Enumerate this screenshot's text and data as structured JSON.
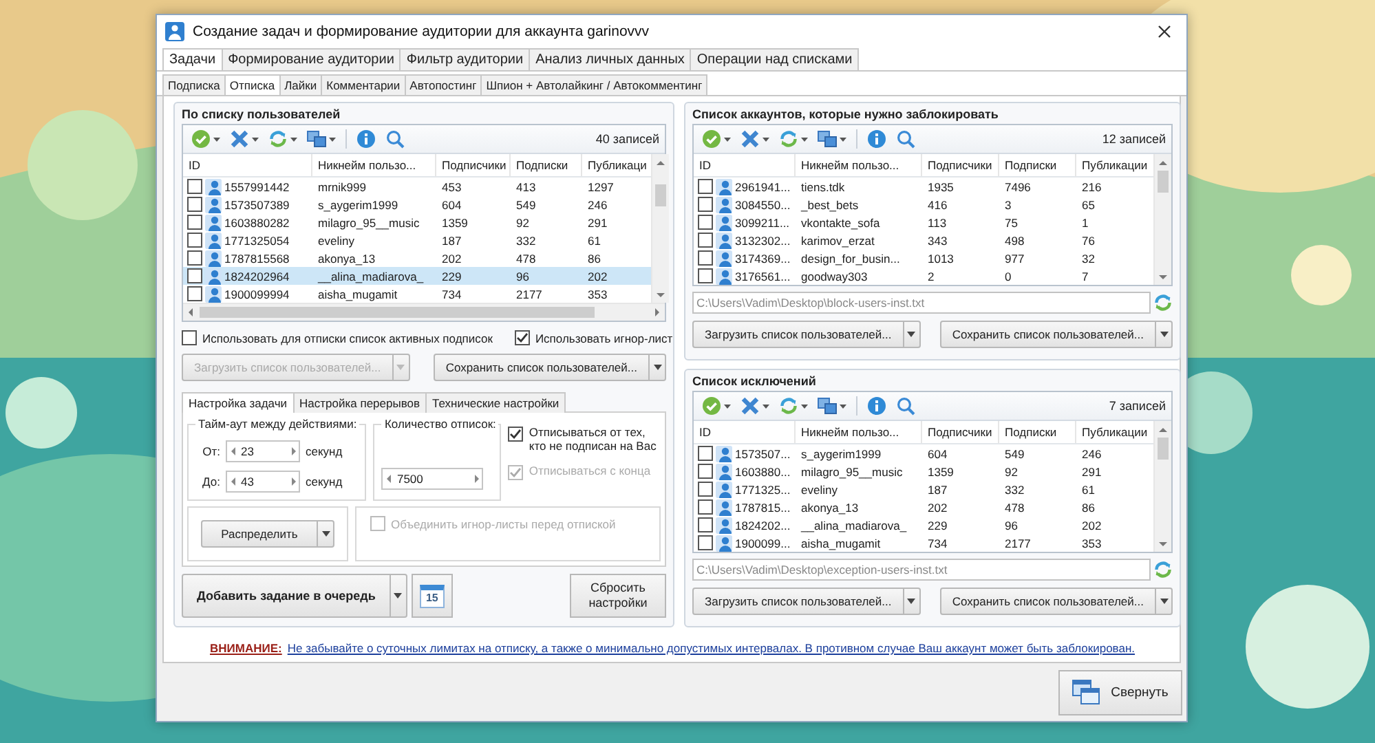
{
  "window": {
    "title": "Создание задач и формирование аудитории для аккаунта garinovvv"
  },
  "main_tabs": [
    {
      "label": "Задачи",
      "selected": true
    },
    {
      "label": "Формирование аудитории",
      "selected": false
    },
    {
      "label": "Фильтр аудитории",
      "selected": false
    },
    {
      "label": "Анализ личных данных",
      "selected": false
    },
    {
      "label": "Операции над списками",
      "selected": false
    }
  ],
  "sub_tabs": [
    {
      "label": "Подписка",
      "selected": false
    },
    {
      "label": "Отписка",
      "selected": true
    },
    {
      "label": "Лайки",
      "selected": false
    },
    {
      "label": "Комментарии",
      "selected": false
    },
    {
      "label": "Автопостинг",
      "selected": false
    },
    {
      "label": "Шпион + Автолайкинг / Автокомментинг",
      "selected": false
    }
  ],
  "user_list": {
    "title": "По списку пользователей",
    "count": "40 записей",
    "columns": [
      "ID",
      "Никнейм пользо...",
      "Подписчики",
      "Подписки",
      "Публикаци"
    ],
    "rows": [
      {
        "checked": false,
        "selected": false,
        "cells": [
          "1557991442",
          "mrnik999",
          "453",
          "413",
          "1297"
        ]
      },
      {
        "checked": false,
        "selected": false,
        "cells": [
          "1573507389",
          "s_aygerim1999",
          "604",
          "549",
          "246"
        ]
      },
      {
        "checked": false,
        "selected": false,
        "cells": [
          "1603880282",
          "milagro_95__music",
          "1359",
          "92",
          "291"
        ]
      },
      {
        "checked": false,
        "selected": false,
        "cells": [
          "1771325054",
          "eveliny",
          "187",
          "332",
          "61"
        ]
      },
      {
        "checked": false,
        "selected": false,
        "cells": [
          "1787815568",
          "akonya_13",
          "202",
          "478",
          "86"
        ]
      },
      {
        "checked": false,
        "selected": true,
        "cells": [
          "1824202964",
          "__alina_madiarova_",
          "229",
          "96",
          "202"
        ]
      },
      {
        "checked": false,
        "selected": false,
        "cells": [
          "1900099994",
          "aisha_mugamit",
          "734",
          "2177",
          "353"
        ]
      }
    ]
  },
  "options": [
    {
      "label": "Использовать для отписки список активных подписок",
      "checked": false
    },
    {
      "label": "Использовать игнор-лист",
      "checked": true
    }
  ],
  "list_buttons": [
    {
      "label": "Загрузить список пользователей...",
      "disabled": true
    },
    {
      "label": "Сохранить список пользователей...",
      "disabled": false
    }
  ],
  "settings_tabs": [
    {
      "label": "Настройка задачи",
      "selected": true
    },
    {
      "label": "Настройка перерывов",
      "selected": false
    },
    {
      "label": "Технические настройки",
      "selected": false
    }
  ],
  "timeout": {
    "title": "Тайм-аут между действиями:",
    "fields": [
      {
        "label": "От:",
        "value": "23",
        "unit": "секунд"
      },
      {
        "label": "До:",
        "value": "43",
        "unit": "секунд"
      }
    ]
  },
  "unfollow_count": {
    "title": "Количество отписок:",
    "value": "7500"
  },
  "task_options": [
    {
      "label": "Отписываться от тех, кто не подписан на Вас",
      "checked": true,
      "disabled": false
    },
    {
      "label": "Отписываться с конца",
      "checked": true,
      "disabled": true
    }
  ],
  "distribute_button": {
    "label": "Распределить"
  },
  "merge_option": {
    "label": "Объединить игнор-листы перед отпиской",
    "checked": false,
    "disabled": true
  },
  "add_button": {
    "label": "Добавить задание в очередь"
  },
  "calendar_button": {
    "day": "15"
  },
  "reset_button": {
    "label": "Сбросить настройки"
  },
  "side_lists": [
    {
      "title": "Список аккаунтов, которые нужно заблокировать",
      "count": "12 записей",
      "columns": [
        "ID",
        "Никнейм пользо...",
        "Подписчики",
        "Подписки",
        "Публикации"
      ],
      "rows": [
        {
          "checked": false,
          "cells": [
            "2961941...",
            "tiens.tdk",
            "1935",
            "7496",
            "216"
          ]
        },
        {
          "checked": false,
          "cells": [
            "3084550...",
            "_best_bets",
            "416",
            "3",
            "65"
          ]
        },
        {
          "checked": false,
          "cells": [
            "3099211...",
            "vkontakte_sofa",
            "113",
            "75",
            "1"
          ]
        },
        {
          "checked": false,
          "cells": [
            "3132302...",
            "karimov_erzat",
            "343",
            "498",
            "76"
          ]
        },
        {
          "checked": false,
          "cells": [
            "3174369...",
            "design_for_busin...",
            "1013",
            "977",
            "32"
          ]
        },
        {
          "checked": false,
          "cells": [
            "3176561...",
            "goodway303",
            "2",
            "0",
            "7"
          ]
        }
      ],
      "path": "C:\\Users\\Vadim\\Desktop\\block-users-inst.txt",
      "buttons": [
        "Загрузить список пользователей...",
        "Сохранить список пользователей..."
      ]
    },
    {
      "title": "Список исключений",
      "count": "7 записей",
      "columns": [
        "ID",
        "Никнейм пользо...",
        "Подписчики",
        "Подписки",
        "Публикации"
      ],
      "rows": [
        {
          "checked": false,
          "cells": [
            "1573507...",
            "s_aygerim1999",
            "604",
            "549",
            "246"
          ]
        },
        {
          "checked": false,
          "cells": [
            "1603880...",
            "milagro_95__music",
            "1359",
            "92",
            "291"
          ]
        },
        {
          "checked": false,
          "cells": [
            "1771325...",
            "eveliny",
            "187",
            "332",
            "61"
          ]
        },
        {
          "checked": false,
          "cells": [
            "1787815...",
            "akonya_13",
            "202",
            "478",
            "86"
          ]
        },
        {
          "checked": false,
          "cells": [
            "1824202...",
            "__alina_madiarova_",
            "229",
            "96",
            "202"
          ]
        },
        {
          "checked": false,
          "cells": [
            "1900099...",
            "aisha_mugamit",
            "734",
            "2177",
            "353"
          ]
        }
      ],
      "path": "C:\\Users\\Vadim\\Desktop\\exception-users-inst.txt",
      "buttons": [
        "Загрузить список пользователей...",
        "Сохранить список пользователей..."
      ]
    }
  ],
  "warning": {
    "label": "ВНИМАНИЕ:",
    "text": "Не забывайте о суточных лимитах на отписку, а также о минимально допустимых интервалах. В противном случае Ваш аккаунт может быть заблокирован."
  },
  "collapse_button": {
    "label": "Свернуть"
  }
}
